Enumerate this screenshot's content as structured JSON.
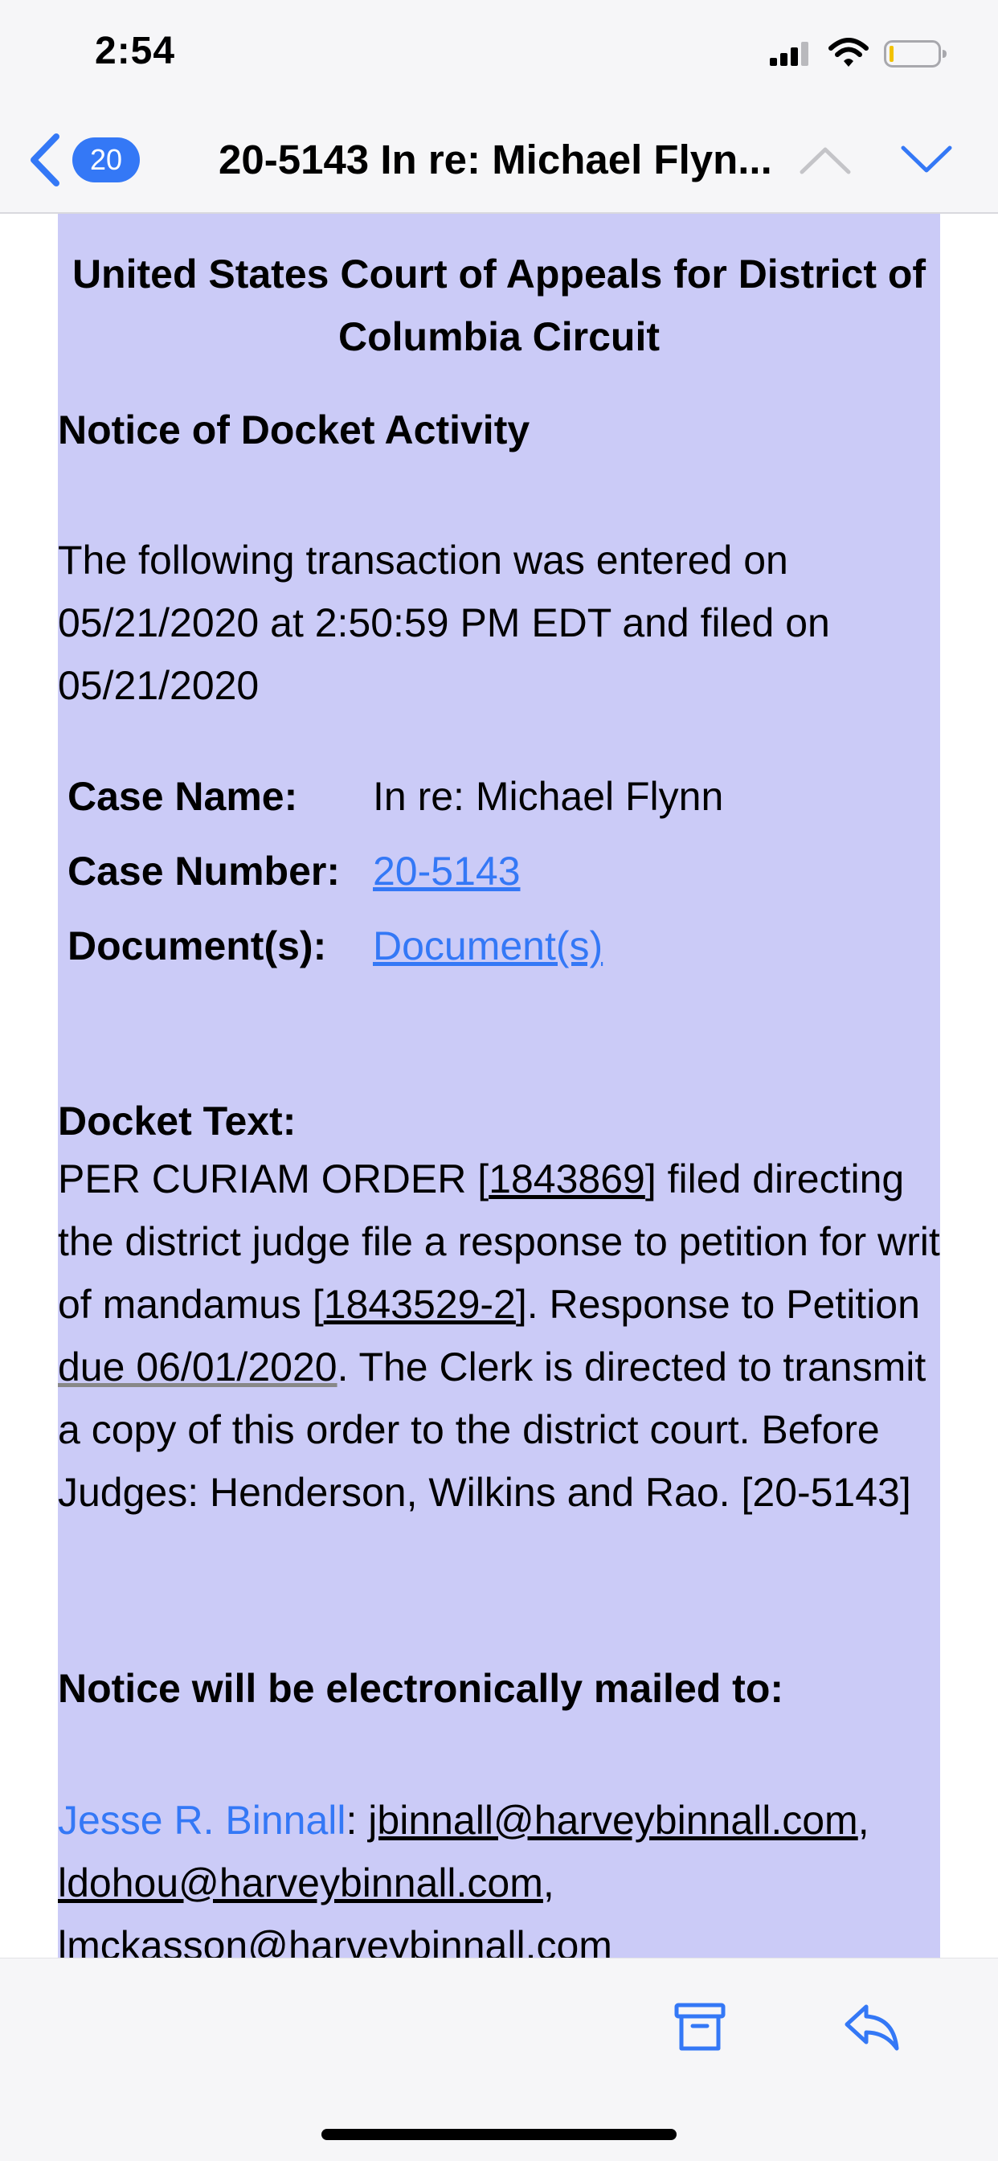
{
  "status_bar": {
    "time": "2:54"
  },
  "nav": {
    "back_count": "20",
    "title": "20-5143 In re: Michael Flyn..."
  },
  "email": {
    "court_title": "United States Court of Appeals for District of Columbia Circuit",
    "notice_heading": "Notice of Docket Activity",
    "intro": "The following transaction was entered on 05/21/2020 at 2:50:59 PM EDT and filed on 05/21/2020",
    "case_rows": [
      {
        "label": "Case Name:",
        "value": "In re: Michael Flynn"
      },
      {
        "label": "Case Number:",
        "value": "20-5143"
      },
      {
        "label": "Document(s):",
        "value": "Document(s)"
      }
    ],
    "docket_heading": "Docket Text:",
    "docket": {
      "p1": "PER CURIAM ORDER [",
      "ref1": "1843869",
      "p2": "] filed directing the district judge file a response to petition for writ of mandamus [",
      "ref2": "1843529-2",
      "p3": "]. Response to Petition ",
      "due": "due 06/01/2020",
      "p4": ". The Clerk is directed to transmit a copy of this order to the district court. Before Judges: Henderson, Wilkins and Rao. [20-5143]"
    },
    "mailed_heading": "Notice will be electronically mailed to:",
    "recipient": {
      "name": "Jesse R. Binnall",
      "sep": ": ",
      "email1": "jbinnall@harveybinnall.com",
      "comma1": ",",
      "email2": "ldohou@harveybinnall.com",
      "comma2": ",",
      "email3": "lmckasson@harveybinnall.com"
    }
  },
  "colors": {
    "accent": "#3478f6",
    "panel_background": "#cbcbf7",
    "bar_background": "#f6f6f8"
  },
  "icons": [
    "signal-icon",
    "wifi-icon",
    "battery-icon",
    "back-chevron-icon",
    "chevron-up-icon",
    "chevron-down-icon",
    "archive-icon",
    "reply-icon"
  ]
}
